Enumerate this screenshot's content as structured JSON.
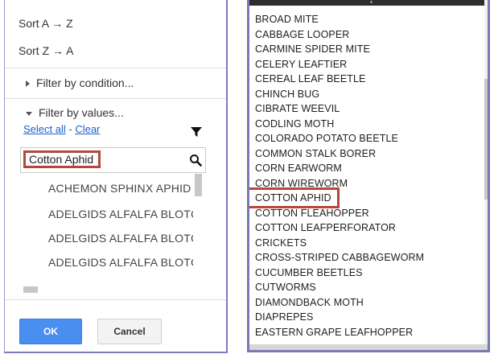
{
  "left_panel": {
    "sort_az": "Sort A → Z",
    "sort_za": "Sort Z → A",
    "filter_condition": "Filter by condition...",
    "filter_values": "Filter by values...",
    "select_all": "Select all",
    "separator": " - ",
    "clear": "Clear",
    "search_value": "Cotton Aphid",
    "values": [
      "ACHEMON SPHINX APHID",
      "ADELGIDS ALFALFA BLOTCH",
      "ADELGIDS ALFALFA BLOTCH",
      "ADELGIDS ALFALFA BLOTCH"
    ],
    "ok_label": "OK",
    "cancel_label": "Cancel"
  },
  "right_panel": {
    "items": [
      "BROAD MITE",
      "CABBAGE LOOPER",
      "CARMINE SPIDER MITE",
      "CELERY LEAFTIER",
      "CEREAL LEAF BEETLE",
      "CHINCH BUG",
      "CIBRATE WEEVIL",
      "CODLING MOTH",
      "COLORADO POTATO BEETLE",
      "COMMON STALK BORER",
      "CORN EARWORM",
      "CORN WIREWORM",
      "COTTON APHID",
      "COTTON FLEAHOPPER",
      "COTTON LEAFPERFORATOR",
      "CRICKETS",
      "CROSS-STRIPED CABBAGEWORM",
      "CUCUMBER BEETLES",
      "CUTWORMS",
      "DIAMONDBACK MOTH",
      "DIAPREPES",
      "EASTERN GRAPE LEAFHOPPER"
    ],
    "highlighted_index": 12
  },
  "colors": {
    "accent_blue": "#4a8ef0",
    "highlight_red": "#b5473c",
    "panel_border": "#7b7bc0"
  }
}
